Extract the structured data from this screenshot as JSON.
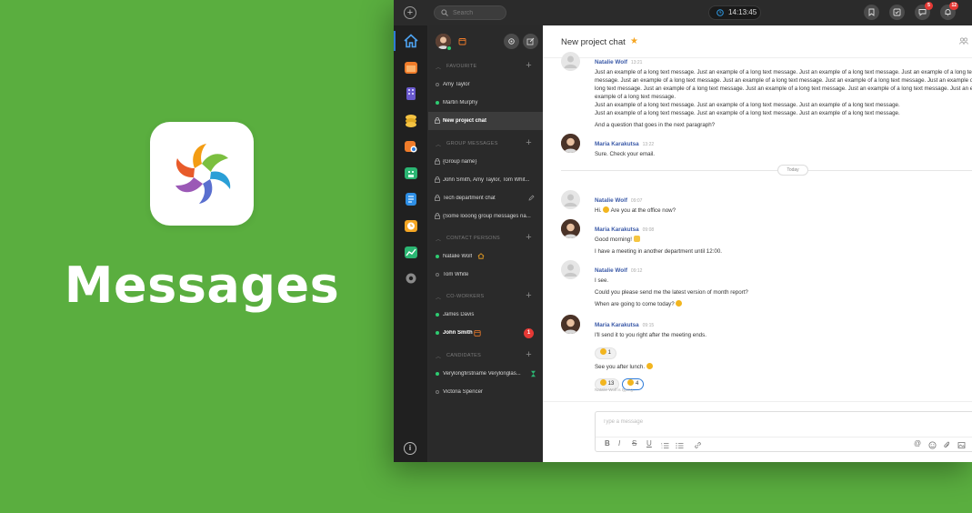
{
  "promo": {
    "title": "Messages",
    "icon": "messages-app-logo"
  },
  "topbar": {
    "search_placeholder": "Search",
    "clock": "14:13:45",
    "badges": {
      "chats": "5",
      "notifications": "12"
    }
  },
  "sidebar": {
    "sections": [
      {
        "label": "FAVOURITE"
      },
      {
        "label": "GROUP MESSAGES"
      },
      {
        "label": "CONTACT PERSONS"
      },
      {
        "label": "CO-WORKERS"
      },
      {
        "label": "CANDIDATES"
      }
    ],
    "items": [
      {
        "name": "Amy Taylor",
        "status": "offline"
      },
      {
        "name": "Martin Murphy",
        "status": "online"
      },
      {
        "name": "New project chat",
        "active": true
      },
      {
        "name": "{Group name}"
      },
      {
        "name": "John Smith, Amy Taylor, Tom Whit..."
      },
      {
        "name": "Tech department chat"
      },
      {
        "name": "{Some looong group messages na..."
      },
      {
        "name": "Natalie Wolf",
        "status": "online"
      },
      {
        "name": "Tom White",
        "status": "offline"
      },
      {
        "name": "James Davis",
        "status": "online"
      },
      {
        "name": "John Smith",
        "status": "online",
        "unread": "1"
      },
      {
        "name": "Verylongfirstname Verylonglas...",
        "status": "online"
      },
      {
        "name": "Victoria Spencer",
        "status": "offline"
      }
    ]
  },
  "chat": {
    "title": "New project chat",
    "day_separator": "Today",
    "messages": [
      {
        "author": "Natalie Wolf",
        "time": "13:21",
        "lines": [
          "Just an example of a long text message. Just an example of a long text message. Just an example of a long text message. Just an example of a long text message. Just an example of a long text",
          "message. Just an example of a long text message. Just an example of a long text message. Just an example of a long text message. Just an example of a long text message. Just an example of a long",
          "long text message. Just an example of a long text message. Just an example of a long text message. Just an example of a long text message. Just an example of a long text message. Just an example",
          "example of a long text message.",
          "Just an example of a long text message. Just an example of a long text message. Just an example of a long text message.",
          "Just an example of a long text message. Just an example of a long text message. Just an example of a long text message.",
          "And a question that goes in the next paragraph?"
        ]
      },
      {
        "author": "Maria Karakutsa",
        "time": "13:22",
        "lines": [
          "Sure. Check your email."
        ]
      },
      {
        "author": "Natalie Wolf",
        "time": "09:07",
        "lines": [
          "Hi. ",
          " Are you at the office now?"
        ]
      },
      {
        "author": "Maria Karakutsa",
        "time": "09:08",
        "lines": [
          "Good morning! ",
          "I have a meeting in another department until 12:00."
        ]
      },
      {
        "author": "Natalie Wolf",
        "time": "09:12",
        "lines": [
          "I see.",
          "Could you please send me the latest version of month report?",
          "When are going to come today? "
        ]
      },
      {
        "author": "Maria Karakutsa",
        "time": "09:15",
        "lines": [
          "I'll send it to you right after the meeting ends.",
          "See you after lunch. "
        ]
      }
    ],
    "reactions": [
      {
        "count": "1"
      },
      {
        "count": "13"
      },
      {
        "count": "4"
      }
    ],
    "typing": "Natalie Wolf is typing...",
    "composer_placeholder": "Type a message",
    "format_tools": [
      "B",
      "I",
      "S",
      "U"
    ]
  }
}
